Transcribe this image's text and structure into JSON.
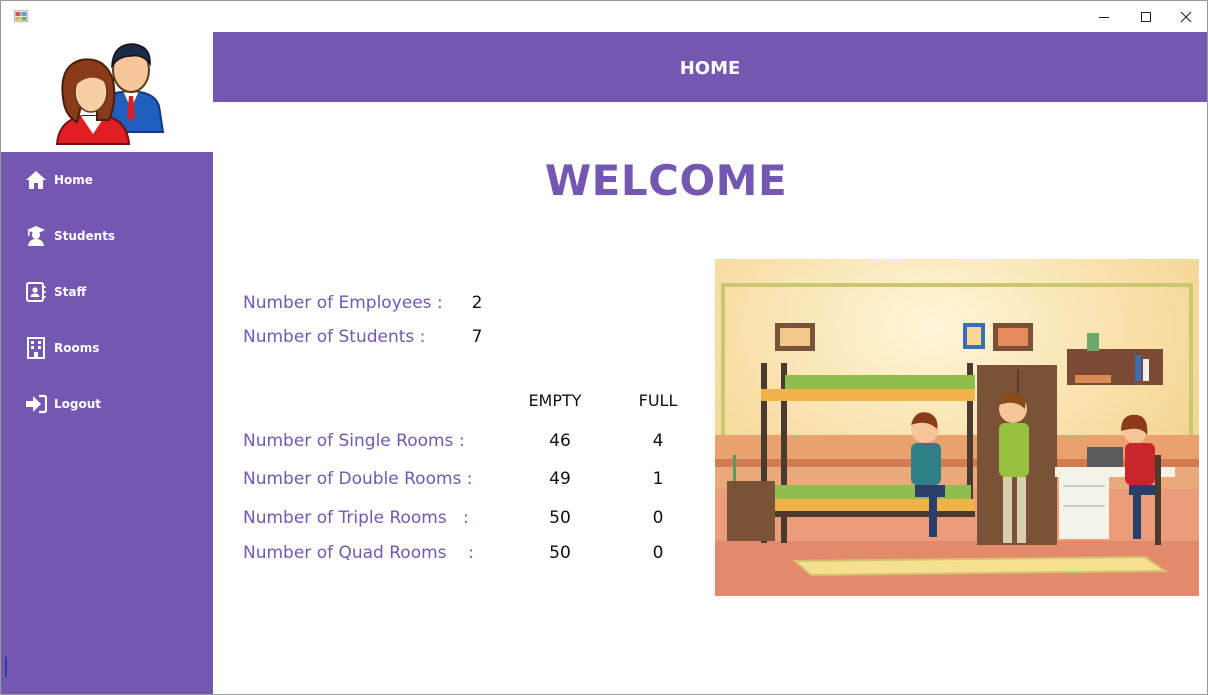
{
  "header": {
    "title": "HOME"
  },
  "welcome": "WELCOME",
  "sidebar": {
    "items": [
      {
        "label": "Home",
        "icon": "home-icon"
      },
      {
        "label": "Students",
        "icon": "graduate-icon"
      },
      {
        "label": "Staff",
        "icon": "contact-card-icon"
      },
      {
        "label": "Rooms",
        "icon": "building-icon"
      },
      {
        "label": "Logout",
        "icon": "logout-arrow-icon"
      }
    ]
  },
  "stats": {
    "employees_label": "Number of Employees :",
    "employees_value": "2",
    "students_label": "Number of Students :",
    "students_value": "7"
  },
  "rooms": {
    "columns": [
      "EMPTY",
      "FULL"
    ],
    "rows": [
      {
        "label": "Number of Single Rooms :",
        "empty": "46",
        "full": "4"
      },
      {
        "label": "Number of Double Rooms :",
        "empty": "49",
        "full": "1"
      },
      {
        "label": "Number of Triple Rooms   :",
        "empty": "50",
        "full": "0"
      },
      {
        "label": "Number of Quad Rooms    :",
        "empty": "50",
        "full": "0"
      }
    ]
  },
  "colors": {
    "accent": "#7457b1",
    "text": "#111111"
  }
}
